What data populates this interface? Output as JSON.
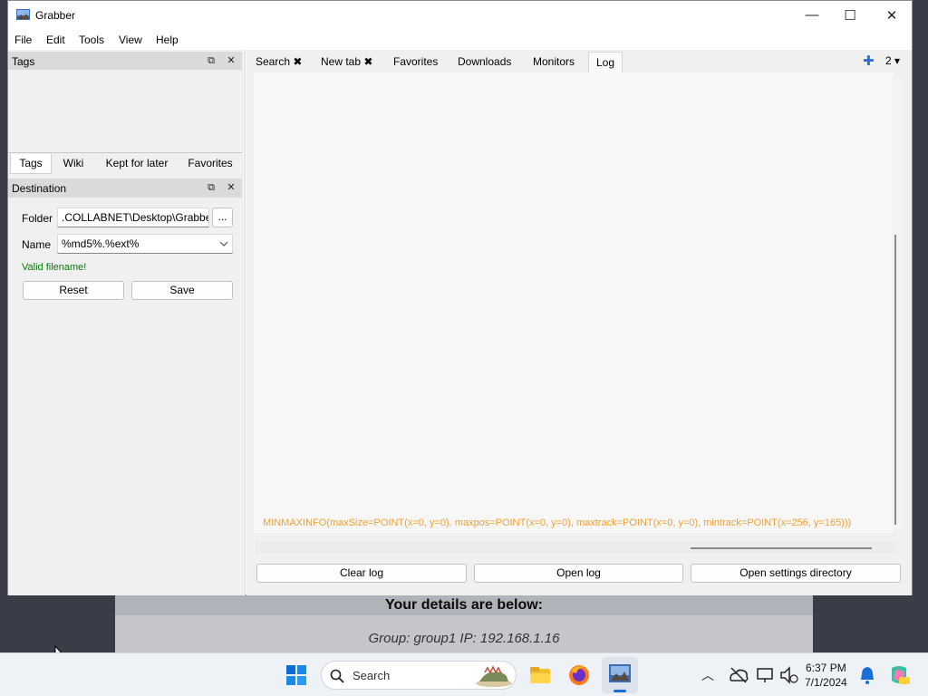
{
  "window": {
    "title": "Grabber",
    "minimize_glyph": "—",
    "maximize_glyph": "☐",
    "close_glyph": "✕"
  },
  "menu": [
    "File",
    "Edit",
    "Tools",
    "View",
    "Help"
  ],
  "left": {
    "tags_dock_title": "Tags",
    "tabs": [
      "Tags",
      "Wiki",
      "Kept for later",
      "Favorites"
    ],
    "destination_dock_title": "Destination",
    "folder_label": "Folder",
    "folder_value": ".COLLABNET\\Desktop\\Grabber",
    "browse_label": "...",
    "name_label": "Name",
    "name_value": "%md5%.%ext%",
    "valid_text": "Valid filename!",
    "reset_label": "Reset",
    "save_label": "Save"
  },
  "right": {
    "tabs": [
      "Search ✖",
      "New tab ✖",
      "Favorites",
      "Downloads",
      "Monitors",
      "Log"
    ],
    "add_tab_glyph": "✚",
    "tab_count": "2 ▾",
    "log_line": "MINMAXINFO(maxSize=POINT(x=0, y=0), maxpos=POINT(x=0, y=0), maxtrack=POINT(x=0, y=0), mintrack=POINT(x=256, y=165)))",
    "clear_log": "Clear log",
    "open_log": "Open log",
    "open_settings": "Open settings directory"
  },
  "background": {
    "details": "Your details are below:",
    "group": "Group: group1   IP: 192.168.1.16"
  },
  "taskbar": {
    "search_placeholder": "Search",
    "time": "6:37 PM",
    "date": "7/1/2024"
  },
  "colors": {
    "log_text": "#f0a030",
    "valid_text": "#008000",
    "taskbar": "#eef1f6"
  }
}
